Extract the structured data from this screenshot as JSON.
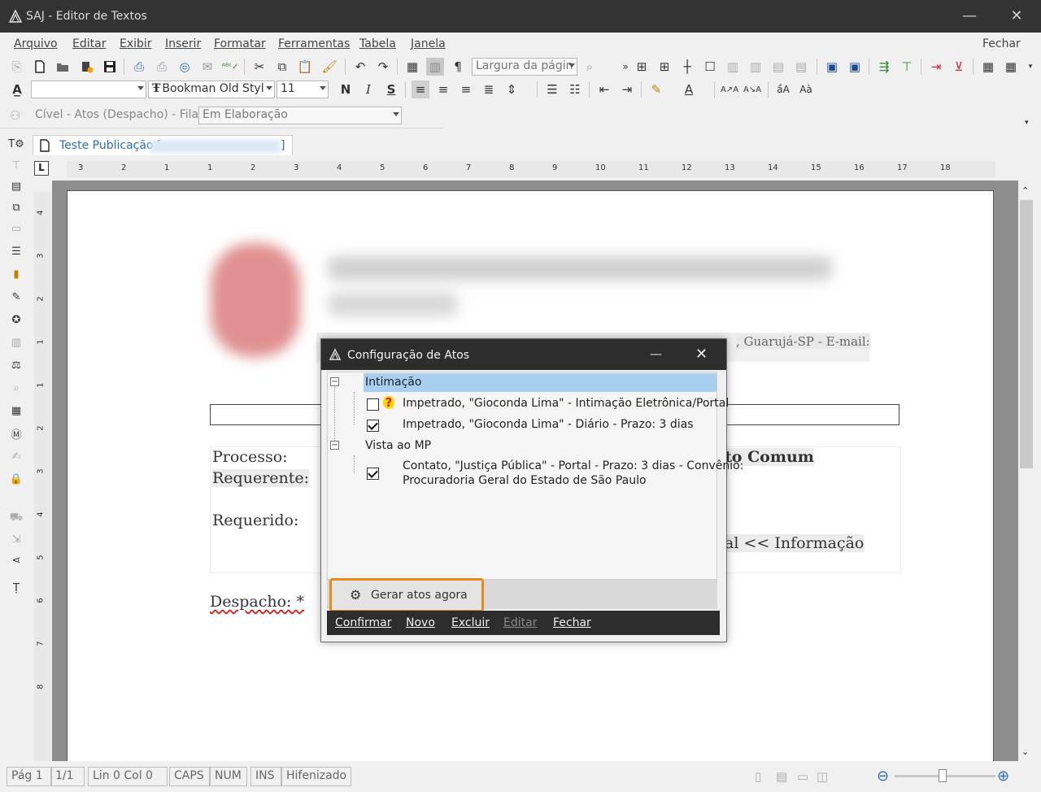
{
  "window": {
    "title": "SAJ - Editor de Textos",
    "minimize": "—",
    "close": "✕"
  },
  "menu": {
    "items": [
      "Arquivo",
      "Editar",
      "Exibir",
      "Inserir",
      "Formatar",
      "Ferramentas",
      "Tabela",
      "Janela"
    ],
    "fechar": "Fechar"
  },
  "toolbar": {
    "zoom_combo": "Largura da págin",
    "font_combo": "Bookman Old Styl",
    "font_size": "11",
    "bold": "N",
    "italic": "I",
    "strike": "S"
  },
  "flow": {
    "label": "Cível - Atos (Despacho) - Fila:",
    "queue": "Em Elaboração"
  },
  "tab": {
    "label": "Teste Publicação [",
    "label_end": "]"
  },
  "ruler": {
    "h_numbers": [
      "3",
      "2",
      "1",
      "1",
      "2",
      "3",
      "4",
      "5",
      "6",
      "7",
      "8",
      "9",
      "10",
      "11",
      "12",
      "13",
      "14",
      "15",
      "16",
      "17",
      "18"
    ],
    "v_numbers": [
      "4",
      "3",
      "2",
      "1",
      "1",
      "2",
      "3",
      "4",
      "5",
      "6",
      "7",
      "8"
    ]
  },
  "document": {
    "email_line": ", Guarujá-SP - E-mail:",
    "processo": "Processo:",
    "requerente": "Requerente:",
    "requerido": "Requerido:",
    "classe": "to Comum",
    "info": "al << Informação",
    "despacho": "Despacho: *"
  },
  "dialog": {
    "title": "Configuração de Atos",
    "minimize": "—",
    "close": "✕",
    "groups": [
      {
        "label": "Intimação",
        "items": [
          {
            "text": "Impetrado, \"Gioconda Lima\" - Intimação Eletrônica/Portal",
            "checked": false,
            "warn": "?"
          },
          {
            "text": "Impetrado, \"Gioconda Lima\" - Diário - Prazo: 3 dias",
            "checked": true
          }
        ]
      },
      {
        "label": "Vista ao MP",
        "items": [
          {
            "text": "Contato, \"Justiça Pública\" - Portal - Prazo: 3 dias - Convênio:",
            "text2": "Procuradoria Geral do Estado de São Paulo",
            "checked": true
          }
        ]
      }
    ],
    "gerar": "Gerar atos agora",
    "footer": [
      "Confirmar",
      "Novo",
      "Excluir",
      "Editar",
      "Fechar"
    ]
  },
  "status": {
    "pag": "Pág 1",
    "pag_total": "1/1",
    "lin_col": "Lin 0  Col 0",
    "caps": "CAPS",
    "num": "NUM",
    "ins": "INS",
    "hifen": "Hifenizado"
  },
  "colors": {
    "accent": "#e68a1a",
    "selection": "#a8cff0",
    "link": "#2a6ebb",
    "titlebar": "#333333"
  }
}
